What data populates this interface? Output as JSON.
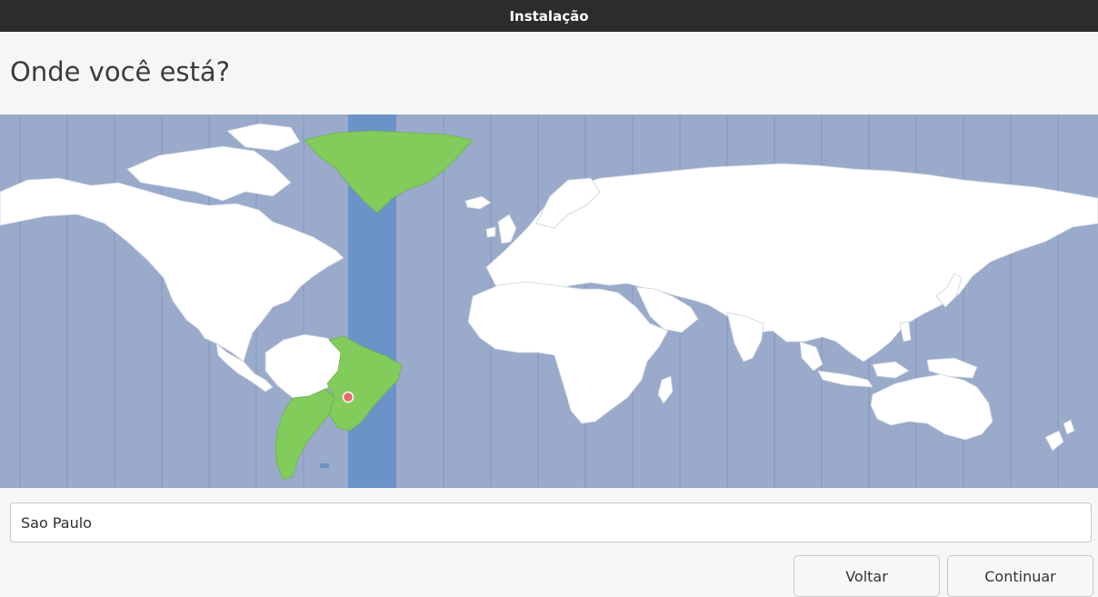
{
  "window": {
    "title": "Instalação"
  },
  "page": {
    "heading": "Onde você está?"
  },
  "map": {
    "ocean_color": "#9aaacb",
    "land_color": "#ffffff",
    "selected_zone_color": "#6c93c8",
    "selected_land_color": "#82cc5c",
    "marker_color": "#e8696b",
    "selected_city": "Sao Paulo"
  },
  "location_input": {
    "value": "Sao Paulo"
  },
  "buttons": {
    "back": "Voltar",
    "next": "Continuar"
  }
}
